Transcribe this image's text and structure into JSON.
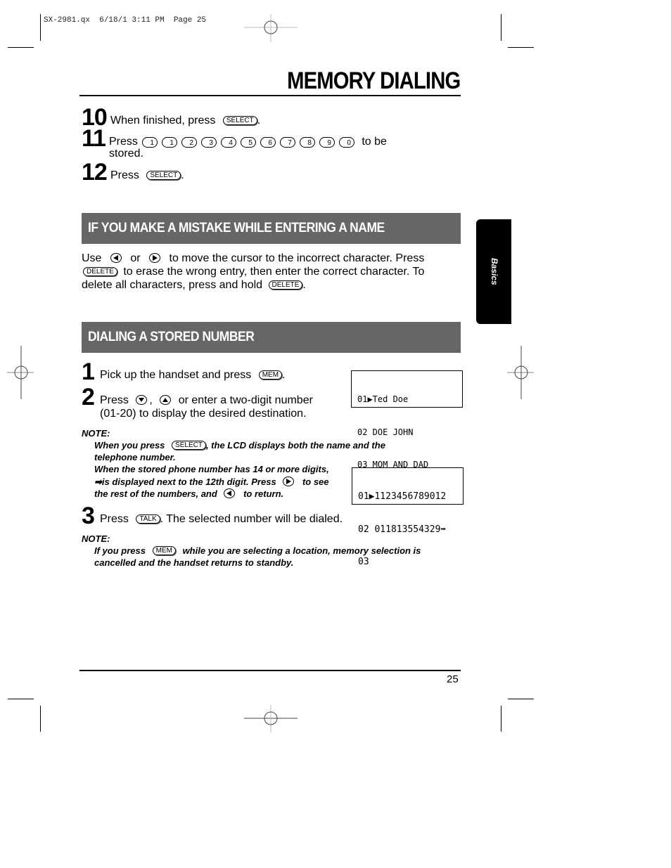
{
  "slug": "SX-2981.qx  6/18/1 3:11 PM  Page 25",
  "title": "MEMORY DIALING",
  "steps_top": [
    {
      "num": "10",
      "pre": "When finished, press",
      "key": "SELECT",
      "post": "."
    },
    {
      "num": "11",
      "pre": "Press",
      "keys": [
        "1",
        "1",
        "2",
        "3",
        "4",
        "5",
        "6",
        "7",
        "8",
        "9",
        "0"
      ],
      "post": "to be",
      "post2": "stored."
    },
    {
      "num": "12",
      "pre": "Press",
      "key": "SELECT",
      "post": "."
    }
  ],
  "section_mistake": {
    "heading": "IF YOU MAKE A MISTAKE WHILE ENTERING A NAME",
    "line1_a": "Use",
    "line1_b": "or",
    "line1_c": "to move the cursor to the incorrect character. Press",
    "line2_key": "DELETE",
    "line2": "to erase the wrong entry, then enter the correct character. To",
    "line3": "delete all characters, press and hold",
    "line3_key": "DELETE",
    "line3_end": "."
  },
  "side_tab": "Basics",
  "section_dialing": {
    "heading": "DIALING A STORED NUMBER",
    "step1": {
      "num": "1",
      "text": "Pick up the handset and press",
      "key": "MEM",
      "post": "."
    },
    "step2": {
      "num": "2",
      "pre": "Press",
      "comma": ",",
      "text": "or enter a two-digit number",
      "line2": "(01-20) to display the desired destination."
    },
    "lcd1": [
      "01▶Ted Doe",
      "02 DOE JOHN",
      "03 MOM AND DAD"
    ],
    "note1": {
      "label": "NOTE:",
      "l1_a": "When you press",
      "l1_key": "SELECT",
      "l1_b": ", the LCD displays both the name and the",
      "l2": "telephone number.",
      "l3": "When the stored phone number has 14 or more digits,",
      "l4_a": "➡is displayed next to the 12th digit.  Press",
      "l4_b": "to see",
      "l5_a": "the rest of the numbers, and",
      "l5_b": "to return."
    },
    "lcd2": [
      "01▶1123456789012",
      "02 011813554329➡",
      "03"
    ],
    "step3": {
      "num": "3",
      "pre": "Press",
      "key": "TALK",
      "text": ".  The selected number will be dialed."
    },
    "note2": {
      "label": "NOTE:",
      "l1_a": "If you press",
      "l1_key": "MEM",
      "l1_b": "while you are selecting a location, memory selection is",
      "l2": "cancelled and the handset returns to standby."
    }
  },
  "page_number": "25"
}
